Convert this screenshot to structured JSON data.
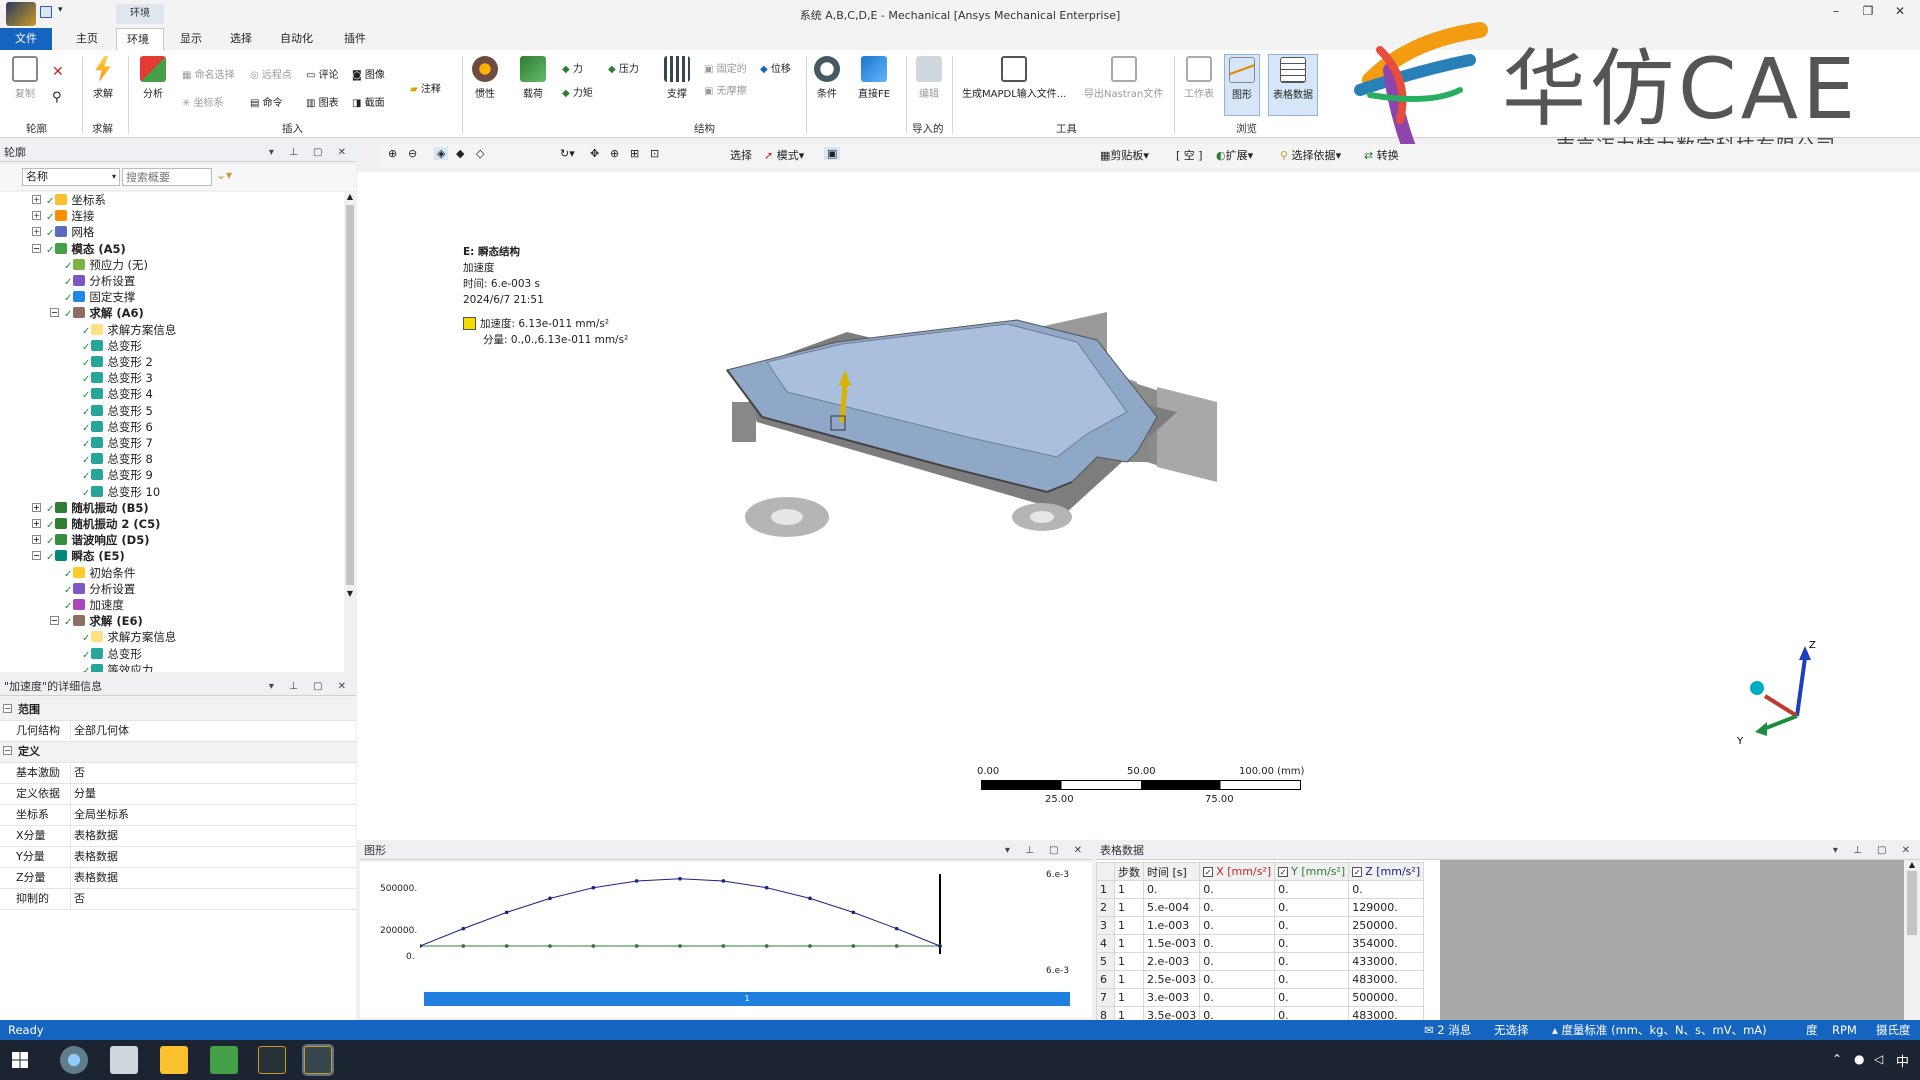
{
  "window": {
    "title": "系统 A,B,C,D,E - Mechanical [Ansys Mechanical Enterprise]",
    "minimize": "–",
    "restore": "❐",
    "close": "✕"
  },
  "ribbon": {
    "context_label": "环境",
    "tabs": [
      "文件",
      "主页",
      "环境",
      "显示",
      "选择",
      "自动化",
      "插件"
    ],
    "outline_group": {
      "copy": "复制",
      "solve": "求解",
      "label": "轮廓",
      "solve_label": "求解"
    },
    "insert_group": {
      "analysis": "分析",
      "named_selection": "命名选择",
      "remote_point": "远程点",
      "comment": "评论",
      "image": "图像",
      "annotation": "注释",
      "coordinate_system": "坐标系",
      "command": "命令",
      "chart": "图表",
      "section": "截面",
      "label": "插入"
    },
    "structural_group": {
      "inertia": "惯性",
      "loads": "载荷",
      "force": "力",
      "pressure": "压力",
      "moment": "力矩",
      "supports": "支撑",
      "fixed": "固定的",
      "frictionless": "无摩擦",
      "displacement": "位移",
      "label": "结构"
    },
    "conditions": "条件",
    "direct_fe": "直接FE",
    "imported_group": {
      "edit": "编辑",
      "label": "导入的"
    },
    "tools_group": {
      "mapdl": "生成MAPDL输入文件...",
      "nastran": "导出Nastran文件",
      "label": "工具"
    },
    "browse_group": {
      "worksheet": "工作表",
      "graph": "图形",
      "tabular": "表格数据",
      "label": "浏览"
    }
  },
  "logo": {
    "brand": "华仿CAE",
    "company": "南京迈力特力数字科技有限公司"
  },
  "outline": {
    "header": "轮廓",
    "name_dropdown": "名称",
    "search_placeholder": "搜索概要",
    "nodes": [
      {
        "label": "坐标系",
        "depth": 1,
        "icon": "coordinate-system",
        "bold": false
      },
      {
        "label": "连接",
        "depth": 1,
        "icon": "connections",
        "bold": false
      },
      {
        "label": "网格",
        "depth": 1,
        "icon": "mesh",
        "bold": false
      },
      {
        "label": "模态 (A5)",
        "depth": 1,
        "icon": "modal",
        "bold": true
      },
      {
        "label": "预应力 (无)",
        "depth": 2,
        "icon": "prestress",
        "bold": false
      },
      {
        "label": "分析设置",
        "depth": 2,
        "icon": "analysis-settings",
        "bold": false
      },
      {
        "label": "固定支撑",
        "depth": 2,
        "icon": "fixed-support",
        "bold": false
      },
      {
        "label": "求解 (A6)",
        "depth": 2,
        "icon": "solution",
        "bold": true
      },
      {
        "label": "求解方案信息",
        "depth": 3,
        "icon": "solution-info",
        "bold": false
      },
      {
        "label": "总变形",
        "depth": 3,
        "icon": "deformation",
        "bold": false
      },
      {
        "label": "总变形 2",
        "depth": 3,
        "icon": "deformation",
        "bold": false
      },
      {
        "label": "总变形 3",
        "depth": 3,
        "icon": "deformation",
        "bold": false
      },
      {
        "label": "总变形 4",
        "depth": 3,
        "icon": "deformation",
        "bold": false
      },
      {
        "label": "总变形 5",
        "depth": 3,
        "icon": "deformation",
        "bold": false
      },
      {
        "label": "总变形 6",
        "depth": 3,
        "icon": "deformation",
        "bold": false
      },
      {
        "label": "总变形 7",
        "depth": 3,
        "icon": "deformation",
        "bold": false
      },
      {
        "label": "总变形 8",
        "depth": 3,
        "icon": "deformation",
        "bold": false
      },
      {
        "label": "总变形 9",
        "depth": 3,
        "icon": "deformation",
        "bold": false
      },
      {
        "label": "总变形 10",
        "depth": 3,
        "icon": "deformation",
        "bold": false
      },
      {
        "label": "随机振动 (B5)",
        "depth": 1,
        "icon": "random-vibration",
        "bold": true
      },
      {
        "label": "随机振动 2 (C5)",
        "depth": 1,
        "icon": "random-vibration",
        "bold": true
      },
      {
        "label": "谐波响应 (D5)",
        "depth": 1,
        "icon": "harmonic",
        "bold": true
      },
      {
        "label": "瞬态 (E5)",
        "depth": 1,
        "icon": "transient",
        "bold": true
      },
      {
        "label": "初始条件",
        "depth": 2,
        "icon": "initial-conditions",
        "bold": false
      },
      {
        "label": "分析设置",
        "depth": 2,
        "icon": "analysis-settings",
        "bold": false
      },
      {
        "label": "加速度",
        "depth": 2,
        "icon": "acceleration",
        "bold": false
      },
      {
        "label": "求解 (E6)",
        "depth": 2,
        "icon": "solution",
        "bold": true
      },
      {
        "label": "求解方案信息",
        "depth": 3,
        "icon": "solution-info",
        "bold": false
      },
      {
        "label": "总变形",
        "depth": 3,
        "icon": "deformation",
        "bold": false
      },
      {
        "label": "等效应力",
        "depth": 3,
        "icon": "stress",
        "bold": false
      }
    ]
  },
  "details": {
    "header": "\"加速度\"的详细信息",
    "rows": [
      {
        "type": "category",
        "label": "范围"
      },
      {
        "type": "row",
        "key": "几何结构",
        "value": "全部几何体"
      },
      {
        "type": "category",
        "label": "定义"
      },
      {
        "type": "row",
        "key": "基本激励",
        "value": "否"
      },
      {
        "type": "row",
        "key": "定义依据",
        "value": "分量"
      },
      {
        "type": "row",
        "key": "坐标系",
        "value": "全局坐标系"
      },
      {
        "type": "row",
        "key": "X分量",
        "value": "表格数据"
      },
      {
        "type": "row",
        "key": "Y分量",
        "value": "表格数据"
      },
      {
        "type": "row",
        "key": "Z分量",
        "value": "表格数据"
      },
      {
        "type": "row",
        "key": "抑制的",
        "value": "否"
      }
    ]
  },
  "view_toolbar": {
    "select": "选择",
    "mode": "模式",
    "clipboard": "剪贴板",
    "empty": "[ 空 ]",
    "extend": "扩展",
    "select_by": "选择依据",
    "convert": "转换"
  },
  "viewport": {
    "legend_title": "E: 瞬态结构",
    "legend_type": "加速度",
    "legend_time": "时间: 6.e-003 s",
    "legend_date": "2024/6/7 21:51",
    "legend_value": "加速度: 6.13e-011 mm/s²",
    "legend_components": "分量: 0.,0.,6.13e-011 mm/s²",
    "scale_top": [
      "0.00",
      "50.00",
      "100.00 (mm)"
    ],
    "scale_bottom": [
      "25.00",
      "75.00"
    ],
    "axes": {
      "z": "Z",
      "y": "Y"
    },
    "colors": {
      "body": "#8fa8c8",
      "arrow": "#d8b400",
      "axis_z": "#1b3fbf",
      "axis_x": "#c0392b",
      "axis_y": "#1e8e3e"
    }
  },
  "graph": {
    "header": "图形",
    "y_ticks": [
      "500000.",
      "200000.",
      "0."
    ],
    "x_end_top": "6.e-3",
    "x_end_bottom": "6.e-3",
    "timeline_label": "1"
  },
  "chart_data": {
    "type": "line",
    "title": "",
    "xlabel": "",
    "ylabel": "",
    "x": [
      0,
      0.0005,
      0.001,
      0.0015,
      0.002,
      0.0025,
      0.003,
      0.0035,
      0.004,
      0.0045,
      0.005,
      0.0055,
      0.006
    ],
    "ylim": [
      0,
      520000
    ],
    "series": [
      {
        "name": "Z [mm/s²]",
        "color": "#1a237e",
        "values": [
          0,
          129000,
          250000,
          354000,
          433000,
          483000,
          500000,
          483000,
          433000,
          354000,
          250000,
          129000,
          0
        ]
      },
      {
        "name": "X [mm/s²]",
        "color": "#c62828",
        "values": [
          0,
          0,
          0,
          0,
          0,
          0,
          0,
          0,
          0,
          0,
          0,
          0,
          0
        ]
      },
      {
        "name": "Y [mm/s²]",
        "color": "#2e7d32",
        "values": [
          0,
          0,
          0,
          0,
          0,
          0,
          0,
          0,
          0,
          0,
          0,
          0,
          0
        ]
      }
    ]
  },
  "table": {
    "header": "表格数据",
    "columns": [
      "步数",
      "时间 [s]",
      "X [mm/s²]",
      "Y [mm/s²]",
      "Z [mm/s²]"
    ],
    "rows": [
      [
        "1",
        "1",
        "0.",
        "0.",
        "0.",
        "0."
      ],
      [
        "2",
        "1",
        "5.e-004",
        "0.",
        "0.",
        "129000."
      ],
      [
        "3",
        "1",
        "1.e-003",
        "0.",
        "0.",
        "250000."
      ],
      [
        "4",
        "1",
        "1.5e-003",
        "0.",
        "0.",
        "354000."
      ],
      [
        "5",
        "1",
        "2.e-003",
        "0.",
        "0.",
        "433000."
      ],
      [
        "6",
        "1",
        "2.5e-003",
        "0.",
        "0.",
        "483000."
      ],
      [
        "7",
        "1",
        "3.e-003",
        "0.",
        "0.",
        "500000."
      ],
      [
        "8",
        "1",
        "3.5e-003",
        "0.",
        "0.",
        "483000."
      ]
    ]
  },
  "status": {
    "ready": "Ready",
    "messages": "2 消息",
    "selection": "无选择",
    "units": "度量标准 (mm、kg、N、s、mV、mA)",
    "angle": "度",
    "rpm": "RPM",
    "temp": "摄氏度"
  },
  "taskbar": {
    "ime": "中"
  }
}
